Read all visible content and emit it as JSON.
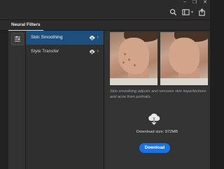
{
  "panel": {
    "title": "Neural Filters"
  },
  "filters": [
    {
      "label": "Skin Smoothing",
      "selected": true
    },
    {
      "label": "Style Transfer",
      "selected": false
    }
  ],
  "preview": {
    "description": "Skin smoothing adjusts and removes skin imperfections and acne from portraits.",
    "download_size": "Download size: 972MB",
    "download_label": "Download"
  },
  "icons": {
    "top": [
      "search-icon",
      "layout-icon",
      "share-icon"
    ],
    "filter_item": [
      "cloud-download-icon",
      "chevron-right-icon"
    ],
    "toolbar": [
      "filter-brush-icon"
    ]
  },
  "colors": {
    "accent": "#1473e6",
    "selected_row": "#1c4f7e",
    "panel_bg": "#333333"
  }
}
